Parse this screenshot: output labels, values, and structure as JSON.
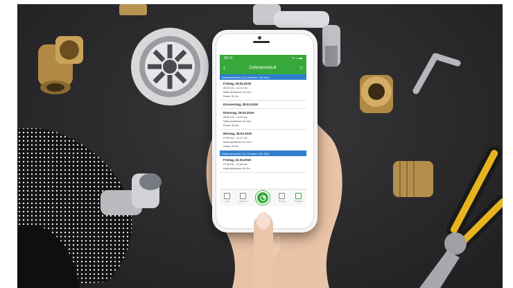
{
  "colors": {
    "app_green": "#37a93a",
    "week_blue": "#2f7fcf",
    "table_bg": "#2b2b2d"
  },
  "app": {
    "status_time": "09:21",
    "title": "Zeitenprotokoll",
    "icons": {
      "back": "chevron-left-icon",
      "filter": "filter-icon"
    }
  },
  "weeks": [
    {
      "header": "Kalenderwoche 13 | Gesamt: 13h 51m",
      "days": [
        {
          "title": "Freitag, 29.03.2019",
          "lines": [
            "09:02 Uhr - 12:13 Uhr",
            "Netto-Arbeitszeit: 3h 11m",
            "Pause: 0h 0m"
          ]
        },
        {
          "title": "Donnerstag, 28.03.2019",
          "lines": []
        },
        {
          "title": "Dienstag, 26.03.2019",
          "lines": [
            "08:06 Uhr - 12:20 Uhr",
            "Netto-Arbeitszeit: 4h 14m",
            "Pause: 0h 0m"
          ]
        },
        {
          "title": "Montag, 25.03.2019",
          "lines": [
            "07:50 Uhr - 12:17 Uhr",
            "Netto-Arbeitszeit: 4h 27m",
            "Pause: 0h 0m"
          ]
        }
      ]
    },
    {
      "header": "Kalenderwoche 12 | Gesamt: 30h 36m",
      "days": [
        {
          "title": "Freitag, 22.03.2019",
          "lines": [
            "07:46 Uhr - 13:46 Uhr",
            "Netto-Arbeitszeit: 6h 0m"
          ]
        }
      ]
    }
  ],
  "tabs": [
    {
      "label": "Start",
      "icon": "home-icon"
    },
    {
      "label": "Kalender",
      "icon": "calendar-icon"
    },
    {
      "label": "",
      "icon": "timer-icon"
    },
    {
      "label": "Berichte",
      "icon": "report-icon"
    },
    {
      "label": "Protokoll",
      "icon": "clipboard-icon"
    }
  ]
}
